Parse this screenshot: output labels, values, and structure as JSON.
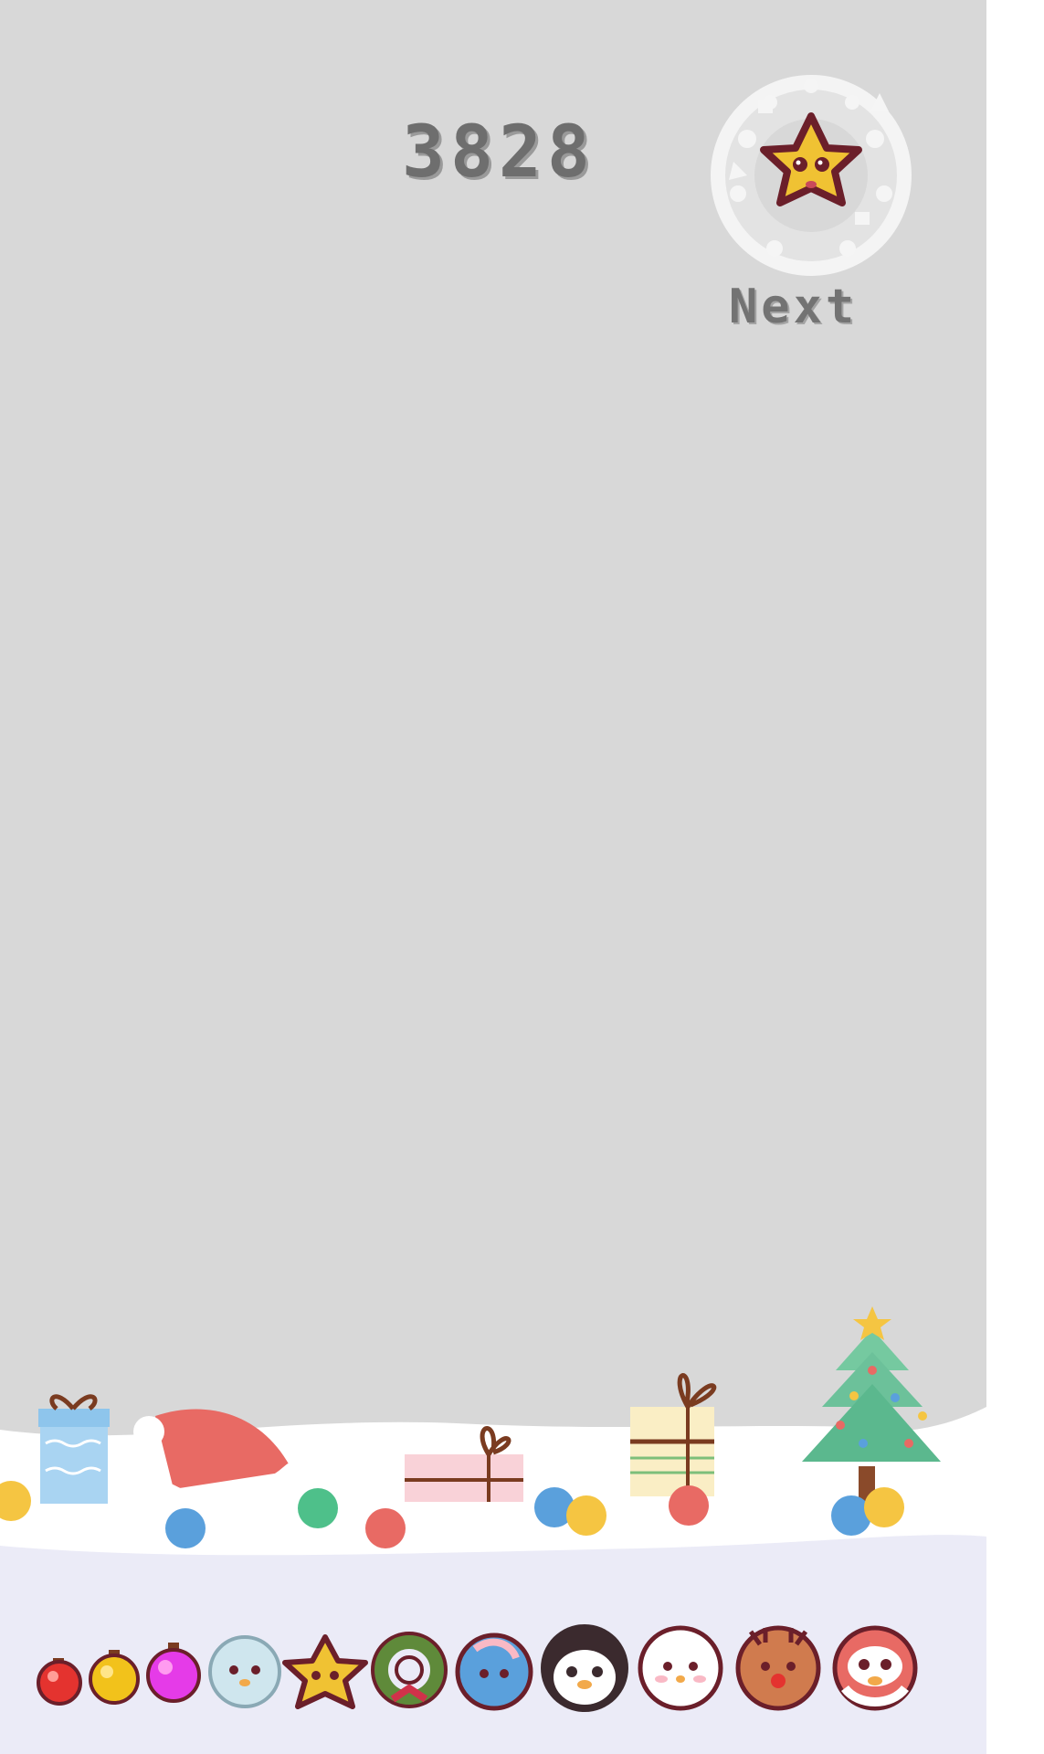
{
  "hud": {
    "score": "3828",
    "next_label": "Next",
    "next_item_icon": "star-icon"
  },
  "evolution_chain": [
    {
      "icon": "red-ornament-icon"
    },
    {
      "icon": "gold-ornament-icon"
    },
    {
      "icon": "pink-ornament-icon"
    },
    {
      "icon": "snowflake-face-icon"
    },
    {
      "icon": "star-face-icon"
    },
    {
      "icon": "wreath-icon"
    },
    {
      "icon": "blue-bauble-face-icon"
    },
    {
      "icon": "penguin-face-icon"
    },
    {
      "icon": "snowman-face-icon"
    },
    {
      "icon": "reindeer-face-icon"
    },
    {
      "icon": "santa-face-icon"
    }
  ],
  "decorations": [
    "gift-box-blue-icon",
    "santa-hat-icon",
    "gift-box-pink-icon",
    "gift-box-striped-icon",
    "christmas-tree-icon"
  ],
  "colors": {
    "background": "#d8d8d8",
    "snow": "#ffffff",
    "floor": "#ebebf7",
    "score_text": "#6e6e6e",
    "star": "#f0c233",
    "dark_outline": "#6b1f2a"
  }
}
